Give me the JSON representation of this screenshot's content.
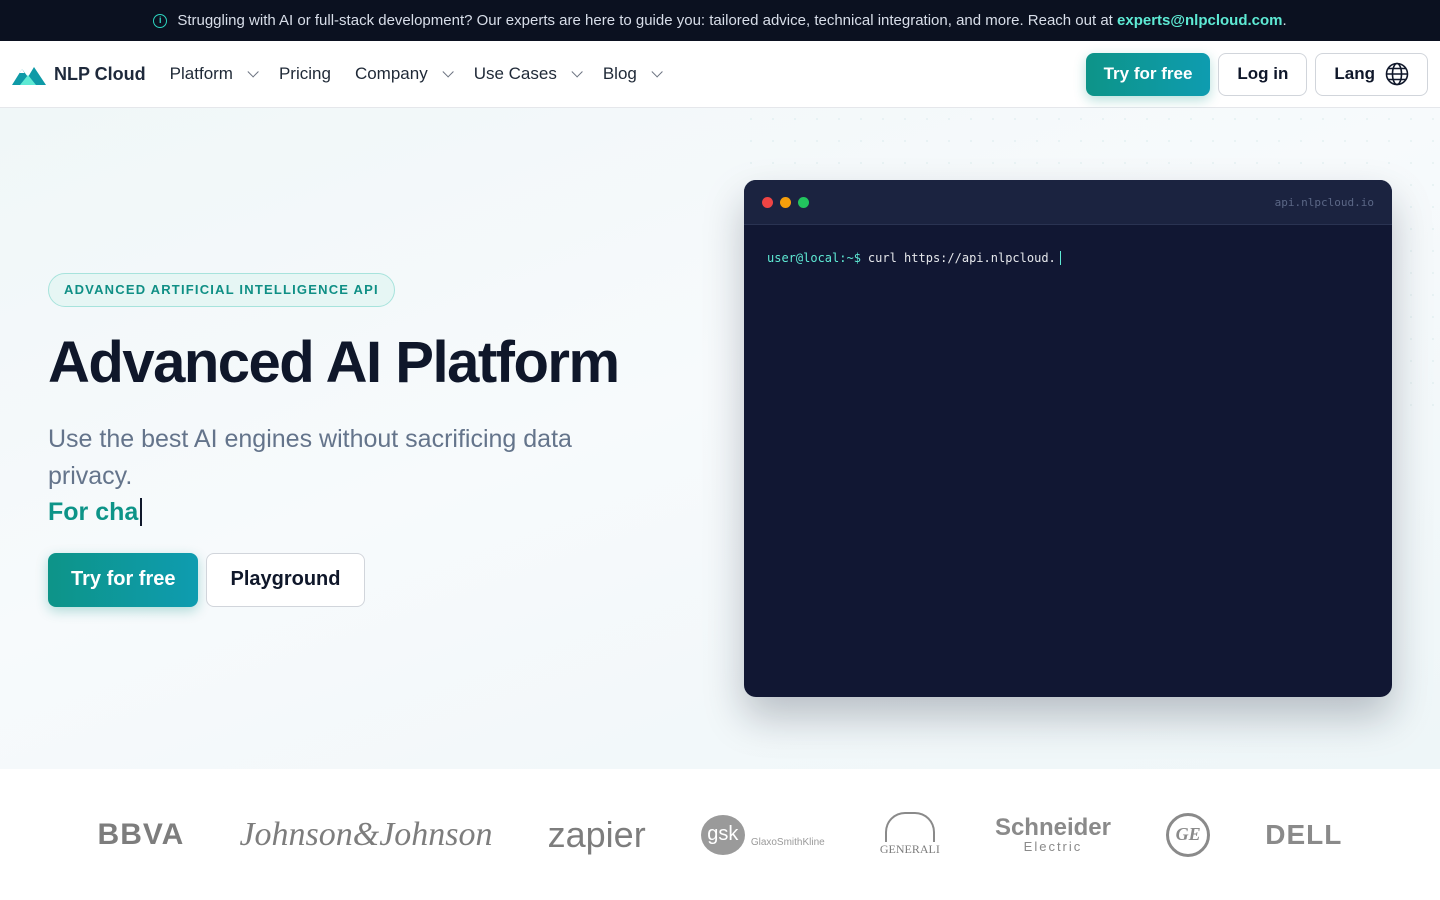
{
  "announcement": {
    "text": "Struggling with AI or full-stack development? Our experts are here to guide you: tailored advice, technical integration, and more. Reach out at",
    "email": "experts@nlpcloud.com",
    "suffix": ".",
    "icon": "info-icon"
  },
  "nav": {
    "brand": "NLP Cloud",
    "brand_icon": "mountain-logo-icon",
    "items": [
      {
        "label": "Platform",
        "dropdown": true
      },
      {
        "label": "Pricing",
        "dropdown": false
      },
      {
        "label": "Company",
        "dropdown": true
      },
      {
        "label": "Use Cases",
        "dropdown": true
      },
      {
        "label": "Blog",
        "dropdown": true
      }
    ],
    "try_label": "Try for free",
    "login_label": "Log in",
    "lang_label": "Lang",
    "lang_icon": "globe-icon"
  },
  "hero": {
    "badge": "ADVANCED ARTIFICIAL INTELLIGENCE API",
    "title": "Advanced AI Platform",
    "subtitle": "Use the best AI engines without sacrificing data privacy.",
    "typed": "For cha",
    "cta_primary": "Try for free",
    "cta_secondary": "Playground"
  },
  "terminal": {
    "url": "api.nlpcloud.io",
    "prompt": "user@local:~$",
    "command": "curl https://api.nlpcloud.",
    "dots": [
      "#ef4444",
      "#f59e0b",
      "#22c55e"
    ]
  },
  "logos": {
    "bbva": "BBVA",
    "jj": "Johnson&Johnson",
    "zapier": "zapier",
    "gsk": "gsk",
    "gsk_sub": "GlaxoSmithKline",
    "generali": "GENERALI",
    "schneider_top": "Schneider",
    "schneider_bottom": "Electric",
    "ge": "GE",
    "dell": "DELL"
  },
  "colors": {
    "accent": "#0d9488",
    "dark": "#0b1120",
    "terminal_bg": "#111733"
  }
}
